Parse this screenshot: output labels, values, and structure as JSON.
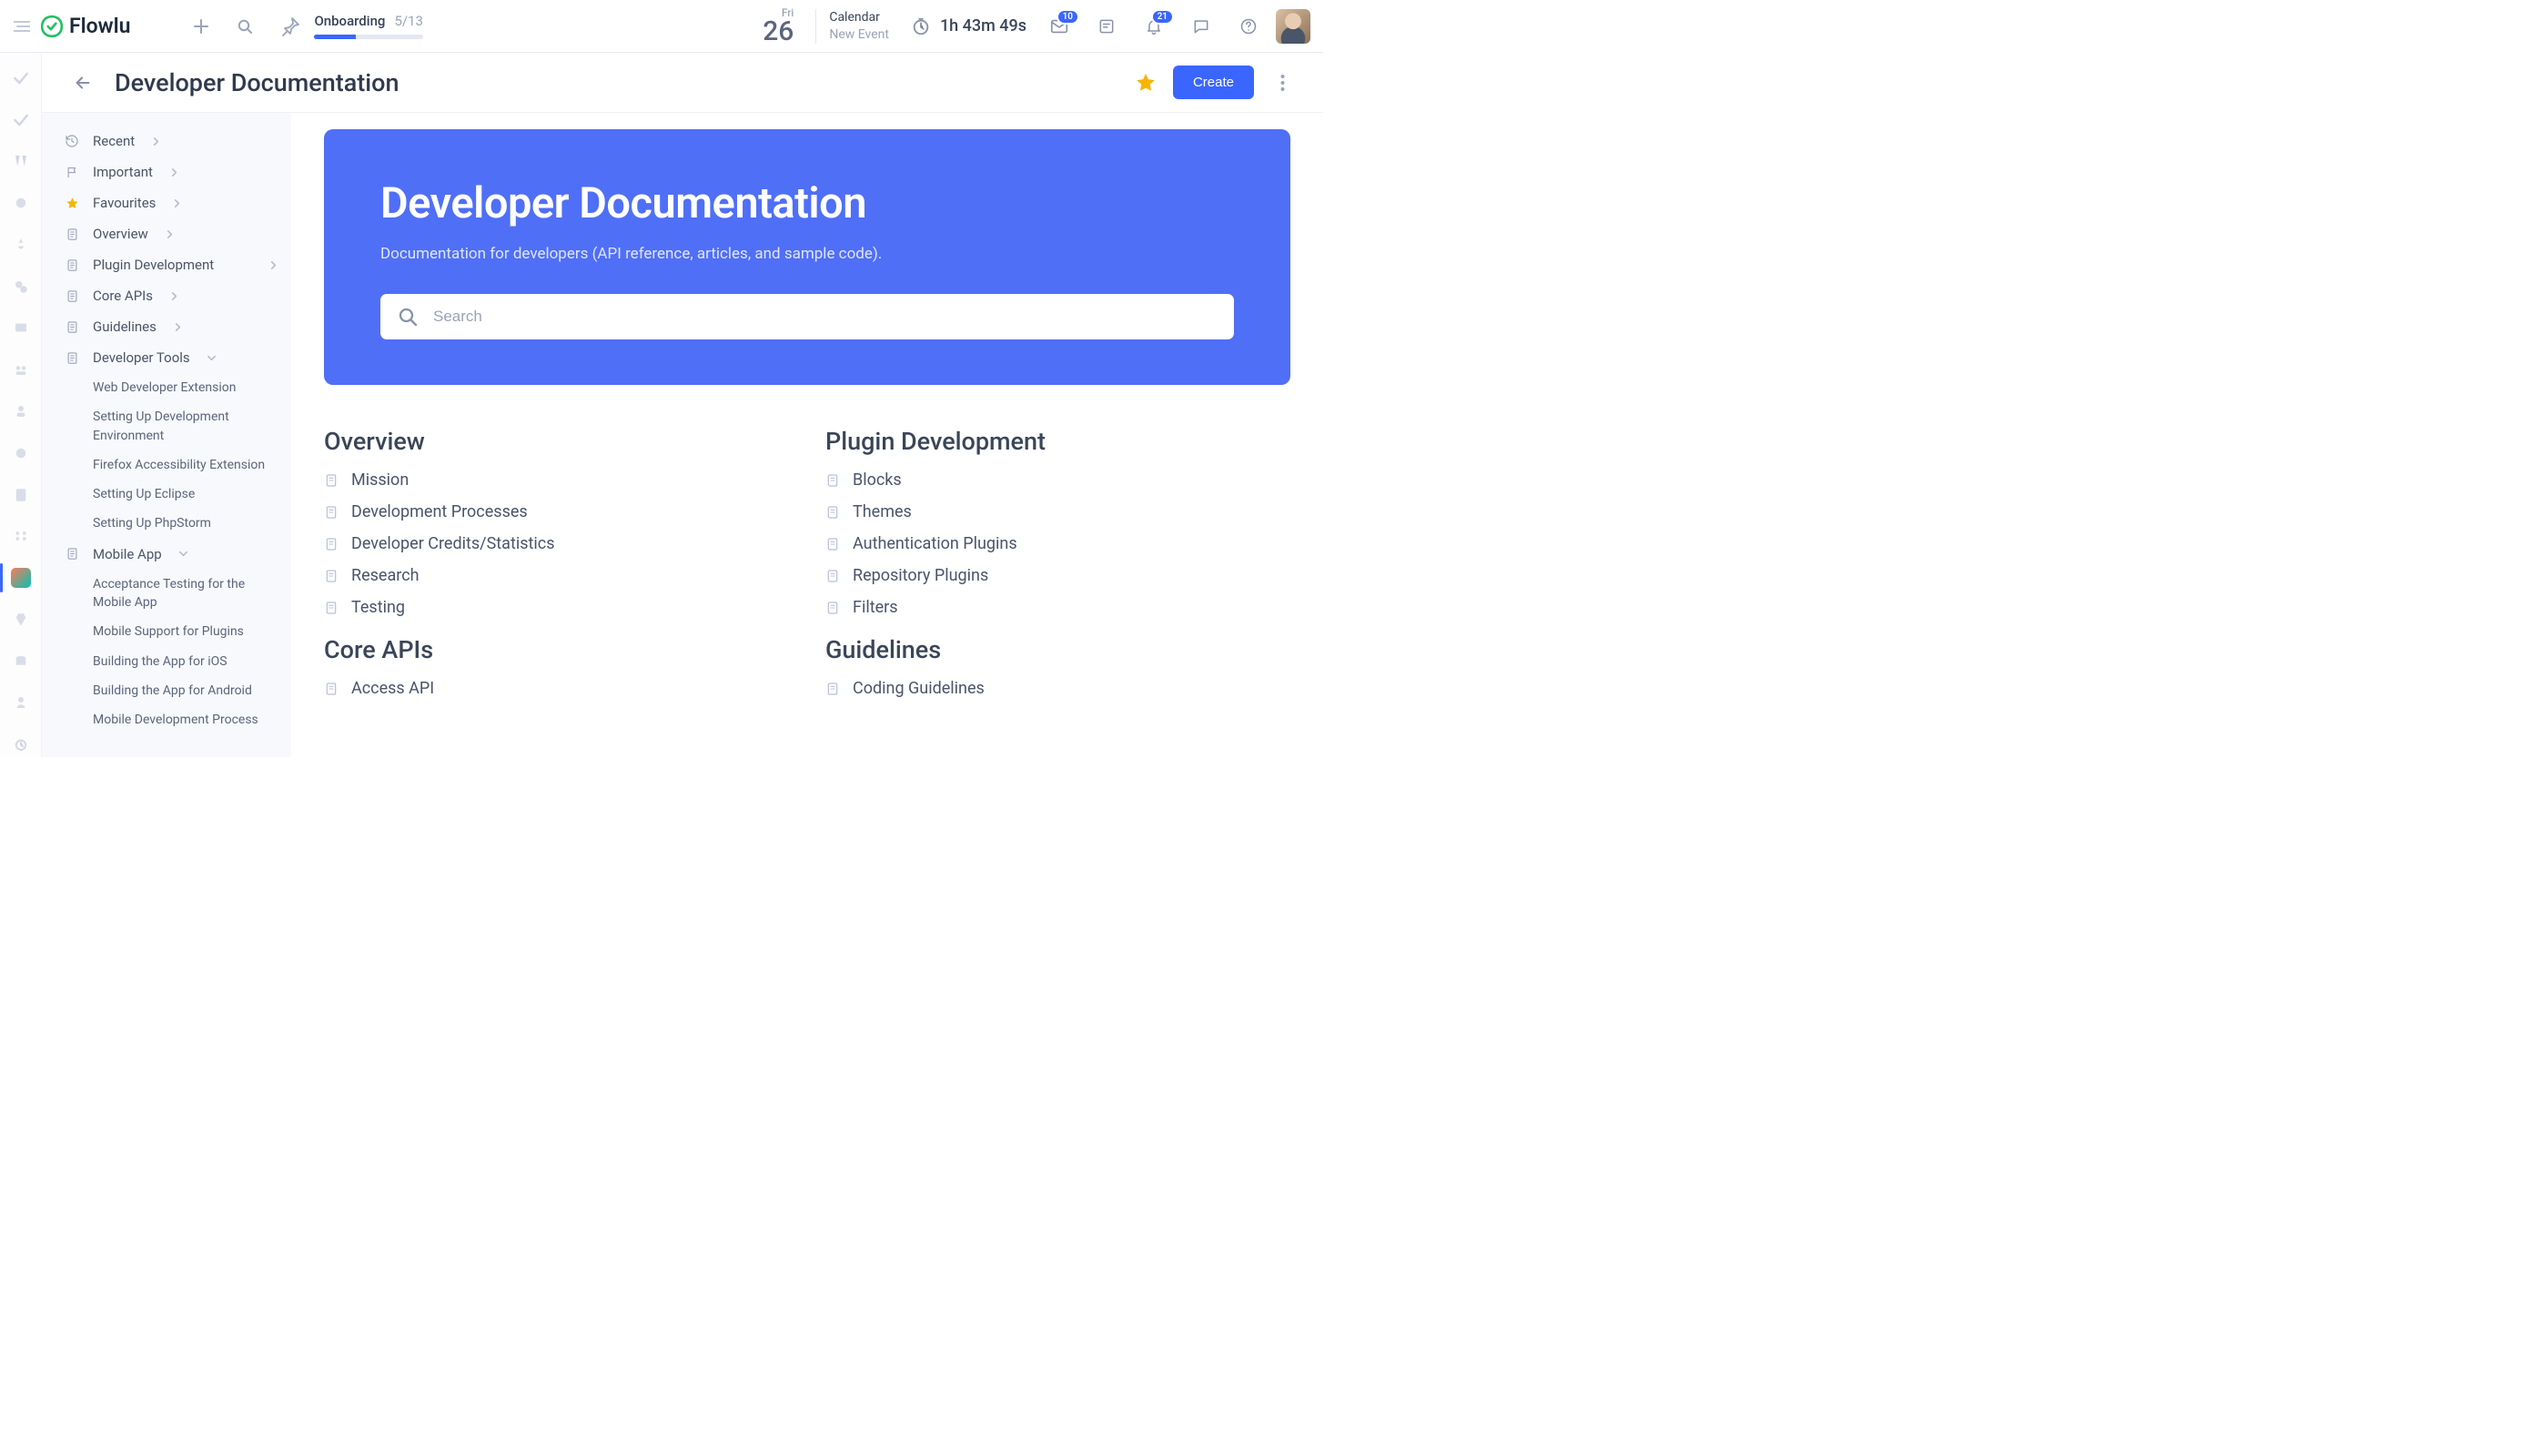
{
  "brand": {
    "name": "Flowlu"
  },
  "topbar": {
    "onboarding": {
      "title": "Onboarding",
      "progress": "5/13",
      "percent": 38
    },
    "date": {
      "weekday": "Fri",
      "daynum": "26"
    },
    "calendar": {
      "title": "Calendar",
      "new_event": "New Event"
    },
    "timer": "1h 43m 49s",
    "inbox_badge": "10",
    "bell_badge": "21"
  },
  "page": {
    "title": "Developer Documentation",
    "create_label": "Create"
  },
  "sidebar": {
    "items": [
      {
        "label": "Recent",
        "icon": "history",
        "chev": "right"
      },
      {
        "label": "Important",
        "icon": "flag",
        "chev": "right"
      },
      {
        "label": "Favourites",
        "icon": "star",
        "chev": "right",
        "fav": true
      },
      {
        "label": "Overview",
        "icon": "doc",
        "chev": "right"
      },
      {
        "label": "Plugin Development",
        "icon": "doc",
        "chev": "right-far"
      },
      {
        "label": "Core APIs",
        "icon": "doc",
        "chev": "right"
      },
      {
        "label": "Guidelines",
        "icon": "doc",
        "chev": "right"
      },
      {
        "label": "Developer Tools",
        "icon": "doc",
        "chev": "down",
        "children": [
          "Web Developer Extension",
          "Setting Up Development Environment",
          "Firefox Accessibility Extension",
          "Setting Up Eclipse",
          "Setting Up PhpStorm"
        ]
      },
      {
        "label": "Mobile App",
        "icon": "doc",
        "chev": "down",
        "children": [
          "Acceptance Testing for the Mobile App",
          "Mobile Support for Plugins",
          "Building the App for iOS",
          "Building the App for Android",
          "Mobile Development Process"
        ]
      }
    ]
  },
  "hero": {
    "title": "Developer Documentation",
    "subtitle": "Documentation for developers (API reference, articles, and sample code).",
    "search_placeholder": "Search"
  },
  "sections": [
    {
      "title": "Overview",
      "links": [
        "Mission",
        "Development Processes",
        "Developer Credits/Statistics",
        "Research",
        "Testing"
      ]
    },
    {
      "title": "Plugin Development",
      "links": [
        "Blocks",
        "Themes",
        "Authentication Plugins",
        "Repository Plugins",
        "Filters"
      ]
    },
    {
      "title": "Core APIs",
      "links": [
        "Access API"
      ]
    },
    {
      "title": "Guidelines",
      "links": [
        "Coding Guidelines"
      ]
    }
  ]
}
